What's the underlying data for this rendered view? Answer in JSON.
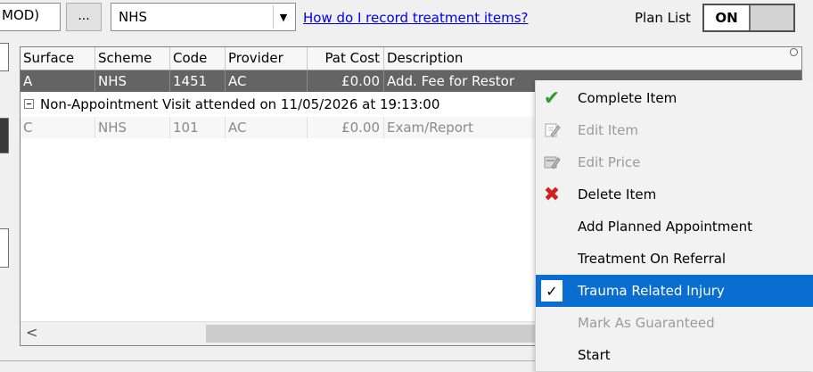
{
  "toolbar": {
    "mod_text": "MOD)",
    "ellipsis_label": "...",
    "scheme_value": "NHS",
    "help_link": "How do I record treatment items?",
    "plan_list_label": "Plan List",
    "toggle_on": "ON"
  },
  "grid": {
    "columns": [
      "Surface",
      "Scheme",
      "Code",
      "Provider",
      "Pat Cost",
      "Description"
    ],
    "selected_row": {
      "surface": "A",
      "scheme": "NHS",
      "code": "1451",
      "provider": "AC",
      "pat_cost": "£0.00",
      "description": "Add. Fee for Restor"
    },
    "group_header": "Non-Appointment Visit attended on 11/05/2026 at 19:13:00",
    "row2": {
      "surface": "C",
      "scheme": "NHS",
      "code": "101",
      "provider": "AC",
      "pat_cost": "£0.00",
      "description": "Exam/Report"
    },
    "scroll_left": "<"
  },
  "context_menu": {
    "items": [
      {
        "label": "Complete Item",
        "icon": "green-check-icon",
        "state": "enabled"
      },
      {
        "label": "Edit Item",
        "icon": "edit-pencil-icon",
        "state": "disabled"
      },
      {
        "label": "Edit Price",
        "icon": "edit-price-icon",
        "state": "disabled"
      },
      {
        "label": "Delete Item",
        "icon": "red-x-icon",
        "state": "enabled"
      },
      {
        "label": "Add Planned Appointment",
        "icon": "",
        "state": "enabled"
      },
      {
        "label": "Treatment On Referral",
        "icon": "",
        "state": "enabled"
      },
      {
        "label": "Trauma Related Injury",
        "icon": "checkmark-icon",
        "state": "highlighted-checked"
      },
      {
        "label": "Mark As Guaranteed",
        "icon": "",
        "state": "disabled"
      },
      {
        "label": "Start",
        "icon": "",
        "state": "enabled"
      }
    ]
  },
  "colors": {
    "selection_highlight": "#0a6ed1",
    "selected_row": "#646464",
    "check_green": "#2e9e2e",
    "delete_red": "#d21f1f",
    "link": "#0000ee"
  }
}
